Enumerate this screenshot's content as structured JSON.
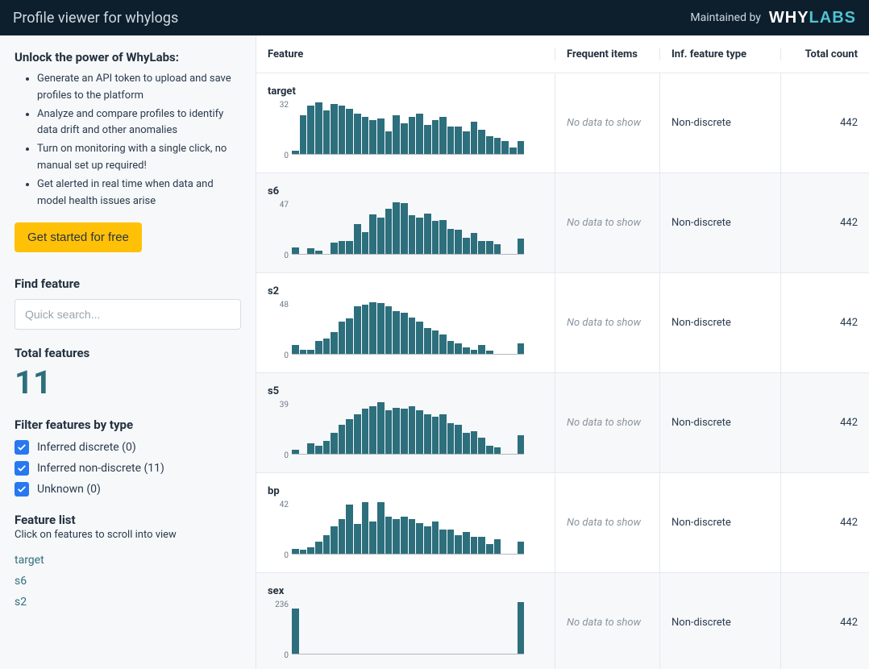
{
  "header": {
    "title": "Profile viewer for whylogs",
    "maintained_by": "Maintained by"
  },
  "sidebar": {
    "promo_title": "Unlock the power of WhyLabs:",
    "promo_items": [
      "Generate an API token to upload and save profiles to the platform",
      "Analyze and compare profiles to identify data drift and other anomalies",
      "Turn on monitoring with a single click, no manual set up required!",
      "Get alerted in real time when data and model health issues arise"
    ],
    "cta_label": "Get started for free",
    "find_feature_label": "Find feature",
    "search_placeholder": "Quick search...",
    "total_features_label": "Total features",
    "total_features_count": "11",
    "filter_title": "Filter features by type",
    "filters": [
      {
        "label": "Inferred discrete (0)",
        "checked": true
      },
      {
        "label": "Inferred non-discrete (11)",
        "checked": true
      },
      {
        "label": "Unknown (0)",
        "checked": true
      }
    ],
    "feature_list_title": "Feature list",
    "feature_list_hint": "Click on features to scroll into view",
    "feature_links": [
      "target",
      "s6",
      "s2"
    ]
  },
  "table": {
    "columns": {
      "feature": "Feature",
      "frequent": "Frequent items",
      "inf_type": "Inf. feature type",
      "total_count": "Total count"
    },
    "rows": [
      {
        "name": "target",
        "frequent": "No data to show",
        "inf_type": "Non-discrete",
        "total_count": "442"
      },
      {
        "name": "s6",
        "frequent": "No data to show",
        "inf_type": "Non-discrete",
        "total_count": "442"
      },
      {
        "name": "s2",
        "frequent": "No data to show",
        "inf_type": "Non-discrete",
        "total_count": "442"
      },
      {
        "name": "s5",
        "frequent": "No data to show",
        "inf_type": "Non-discrete",
        "total_count": "442"
      },
      {
        "name": "bp",
        "frequent": "No data to show",
        "inf_type": "Non-discrete",
        "total_count": "442"
      },
      {
        "name": "sex",
        "frequent": "No data to show",
        "inf_type": "Non-discrete",
        "total_count": "442"
      }
    ]
  },
  "chart_data": [
    {
      "type": "bar",
      "feature": "target",
      "ylim": [
        0,
        32
      ],
      "ymax_label": "32",
      "ymin_label": "0",
      "values": [
        2,
        24,
        30,
        32,
        27,
        31,
        30,
        28,
        25,
        23,
        21,
        22,
        14,
        24,
        19,
        23,
        25,
        18,
        21,
        23,
        17,
        17,
        14,
        20,
        15,
        11,
        10,
        8,
        4,
        8
      ]
    },
    {
      "type": "bar",
      "feature": "s6",
      "ylim": [
        0,
        47
      ],
      "ymax_label": "47",
      "ymin_label": "0",
      "values": [
        6,
        0,
        5,
        3,
        0,
        10,
        12,
        12,
        27,
        20,
        36,
        33,
        41,
        47,
        46,
        35,
        33,
        37,
        30,
        31,
        23,
        22,
        15,
        19,
        12,
        12,
        9,
        0,
        0,
        14
      ]
    },
    {
      "type": "bar",
      "feature": "s2",
      "ylim": [
        0,
        48
      ],
      "ymax_label": "48",
      "ymin_label": "0",
      "values": [
        8,
        4,
        4,
        12,
        14,
        20,
        30,
        33,
        44,
        46,
        48,
        47,
        44,
        40,
        38,
        34,
        30,
        24,
        22,
        18,
        12,
        10,
        6,
        4,
        8,
        3,
        0,
        0,
        0,
        10
      ]
    },
    {
      "type": "bar",
      "feature": "s5",
      "ylim": [
        0,
        39
      ],
      "ymax_label": "39",
      "ymin_label": "0",
      "values": [
        3,
        0,
        8,
        6,
        10,
        16,
        22,
        26,
        30,
        34,
        36,
        39,
        33,
        35,
        34,
        36,
        33,
        30,
        28,
        30,
        23,
        22,
        16,
        17,
        12,
        6,
        5,
        0,
        0,
        14
      ]
    },
    {
      "type": "bar",
      "feature": "bp",
      "ylim": [
        0,
        42
      ],
      "ymax_label": "42",
      "ymin_label": "0",
      "values": [
        4,
        3,
        5,
        10,
        15,
        22,
        28,
        40,
        24,
        42,
        26,
        42,
        30,
        28,
        30,
        28,
        25,
        22,
        26,
        20,
        20,
        15,
        18,
        14,
        14,
        8,
        12,
        0,
        0,
        10
      ]
    },
    {
      "type": "bar",
      "feature": "sex",
      "ylim": [
        0,
        236
      ],
      "ymax_label": "236",
      "ymin_label": "0",
      "values": [
        207,
        0,
        0,
        0,
        0,
        0,
        0,
        0,
        0,
        0,
        0,
        0,
        0,
        0,
        0,
        0,
        0,
        0,
        0,
        0,
        0,
        0,
        0,
        0,
        0,
        0,
        0,
        0,
        0,
        236
      ]
    }
  ]
}
